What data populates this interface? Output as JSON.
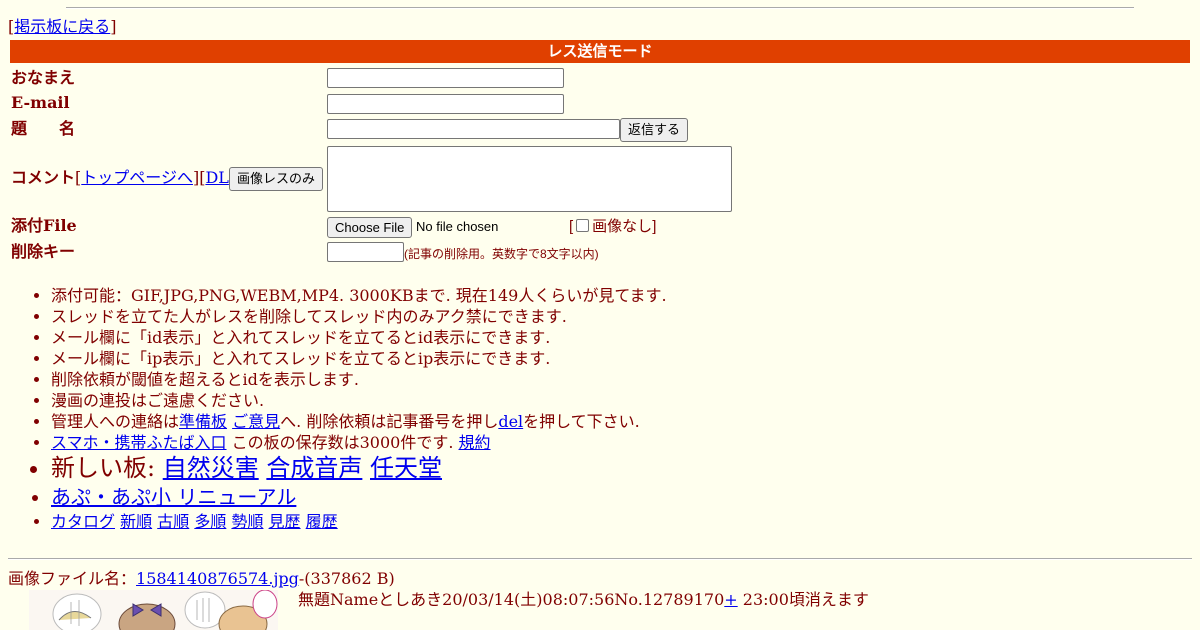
{
  "back": {
    "open": "[",
    "link": "掲示板に戻る",
    "close": "]"
  },
  "mode_title": "レス送信モード",
  "form": {
    "name_label": "おなまえ",
    "email_label": "E-mail",
    "subject_label": "題　　名",
    "submit_button": "返信する",
    "comment_label": "コメント",
    "comment_links": {
      "open": "[",
      "top": "トップページへ",
      "mid": "][",
      "dl": "DL",
      "close": "]"
    },
    "image_only_button": "画像レスのみ",
    "file_label": "添付File",
    "choose_file": "Choose File",
    "no_file": "No file chosen",
    "no_image": {
      "open": "[",
      "label": "画像なし",
      "close": "]"
    },
    "delkey_label": "削除キー",
    "delkey_note": "(記事の削除用。英数字で8文字以内)"
  },
  "notes": {
    "n1": "添付可能：GIF,JPG,PNG,WEBM,MP4. 3000KBまで. 現在149人くらいが見てます.",
    "n2": "スレッドを立てた人がレスを削除してスレッド内のみアク禁にできます.",
    "n3": "メール欄に「id表示」と入れてスレッドを立てるとid表示にできます.",
    "n4": "メール欄に「ip表示」と入れてスレッドを立てるとip表示にできます.",
    "n5": "削除依頼が閾値を超えるとidを表示します.",
    "n6": "漫画の連投はご遠慮ください.",
    "n7": {
      "pre": "管理人への連絡は",
      "link1": "準備板",
      "sp": " ",
      "link2": "ご意見",
      "mid": "へ. 削除依頼は記事番号を押し",
      "link3": "del",
      "post": "を押して下さい."
    },
    "n8": {
      "link1": "スマホ・携帯ふたば入口",
      "mid": " この板の保存数は3000件です. ",
      "link2": "規約"
    },
    "n9": {
      "pre": "新しい板: ",
      "link1": "自然災害",
      "link2": "合成音声",
      "link3": "任天堂"
    },
    "n10": "あぷ・あぷ小 リニューアル",
    "n11": [
      "カタログ",
      "新順",
      "古順",
      "多順",
      "勢順",
      "見歴",
      "履歴"
    ]
  },
  "post": {
    "file_prefix": "画像ファイル名：",
    "filename": "1584140876574.jpg",
    "filesize": "-(337862 B)",
    "header": "無題Nameとしあき20/03/14(土)08:07:56No.12789170",
    "plus": "+",
    "expire": " 23:00頃消えます"
  },
  "colors": {
    "background": "#ffffee",
    "text": "#800000",
    "bar": "#e04000",
    "link": "#0000ee"
  }
}
